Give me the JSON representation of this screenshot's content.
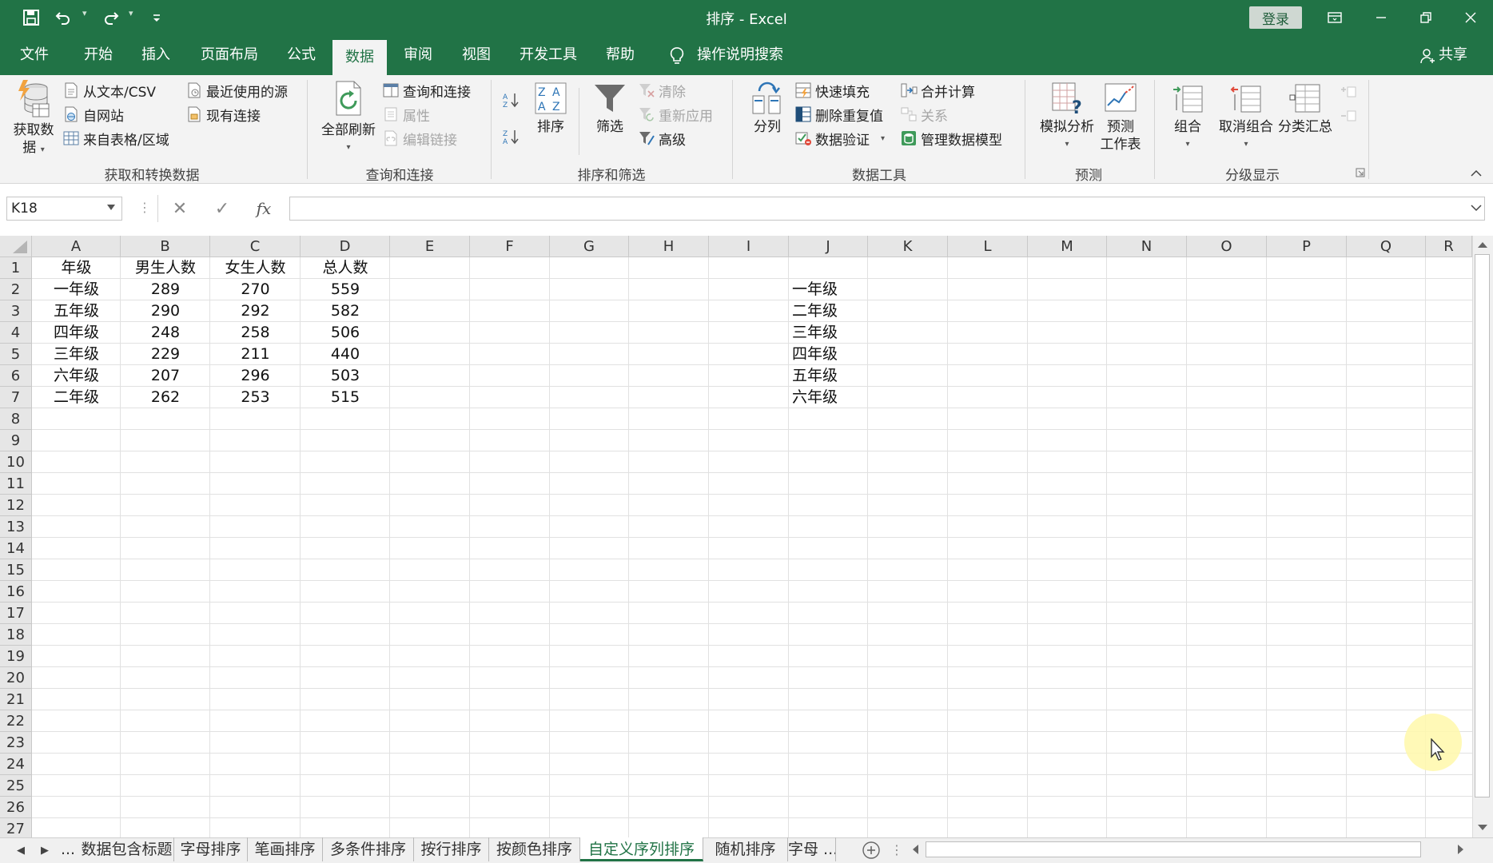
{
  "window": {
    "title": "排序 - Excel",
    "login_label": "登录"
  },
  "ribbon_tabs": [
    {
      "label": "文件"
    },
    {
      "label": "开始"
    },
    {
      "label": "插入"
    },
    {
      "label": "页面布局"
    },
    {
      "label": "公式"
    },
    {
      "label": "数据",
      "active": true
    },
    {
      "label": "审阅"
    },
    {
      "label": "视图"
    },
    {
      "label": "开发工具"
    },
    {
      "label": "帮助"
    }
  ],
  "tell_me": "操作说明搜索",
  "share_label": "共享",
  "ribbon": {
    "get_data": {
      "big_label_1": "获取数",
      "big_label_2": "据",
      "from_text_csv": "从文本/CSV",
      "from_web": "自网站",
      "from_table": "来自表格/区域",
      "recent_sources": "最近使用的源",
      "existing_connections": "现有连接",
      "group_label": "获取和转换数据"
    },
    "queries": {
      "refresh_all": "全部刷新",
      "queries_connections": "查询和连接",
      "properties": "属性",
      "edit_links": "编辑链接",
      "group_label": "查询和连接"
    },
    "sort_filter": {
      "sort": "排序",
      "filter": "筛选",
      "clear": "清除",
      "reapply": "重新应用",
      "advanced": "高级",
      "group_label": "排序和筛选"
    },
    "data_tools": {
      "text_to_columns": "分列",
      "flash_fill": "快速填充",
      "remove_duplicates": "删除重复值",
      "data_validation": "数据验证",
      "consolidate": "合并计算",
      "relationships": "关系",
      "manage_data_model": "管理数据模型",
      "group_label": "数据工具"
    },
    "forecast": {
      "what_if": "模拟分析",
      "forecast_sheet_1": "预测",
      "forecast_sheet_2": "工作表",
      "group_label": "预测"
    },
    "outline": {
      "group": "组合",
      "ungroup": "取消组合",
      "subtotal": "分类汇总",
      "group_label": "分级显示"
    }
  },
  "formula_bar": {
    "name_box": "K18",
    "fx": "fx",
    "formula": ""
  },
  "columns": [
    "A",
    "B",
    "C",
    "D",
    "E",
    "F",
    "G",
    "H",
    "I",
    "J",
    "K",
    "L",
    "M",
    "N",
    "O",
    "P",
    "Q",
    "R"
  ],
  "rows": [
    "1",
    "2",
    "3",
    "4",
    "5",
    "6",
    "7",
    "8",
    "9",
    "10",
    "11",
    "12",
    "13",
    "14",
    "15",
    "16",
    "17",
    "18",
    "19",
    "20",
    "21",
    "22",
    "23",
    "24",
    "25",
    "26",
    "27"
  ],
  "table": {
    "headers": [
      "年级",
      "男生人数",
      "女生人数",
      "总人数"
    ],
    "rows": [
      [
        "一年级",
        "289",
        "270",
        "559"
      ],
      [
        "五年级",
        "290",
        "292",
        "582"
      ],
      [
        "四年级",
        "248",
        "258",
        "506"
      ],
      [
        "三年级",
        "229",
        "211",
        "440"
      ],
      [
        "六年级",
        "207",
        "296",
        "503"
      ],
      [
        "二年级",
        "262",
        "253",
        "515"
      ]
    ]
  },
  "custom_list": [
    "一年级",
    "二年级",
    "三年级",
    "四年级",
    "五年级",
    "六年级"
  ],
  "sheet_tabs": {
    "overflow": "...",
    "tabs": [
      {
        "label": "数据包含标题"
      },
      {
        "label": "字母排序"
      },
      {
        "label": "笔画排序"
      },
      {
        "label": "多条件排序"
      },
      {
        "label": "按行排序"
      },
      {
        "label": "按颜色排序"
      },
      {
        "label": "自定义序列排序",
        "active": true
      },
      {
        "label": "随机排序"
      },
      {
        "label": "字母 ..."
      }
    ]
  },
  "colors": {
    "excel_green": "#217346",
    "ribbon_bg": "#f3f3f3",
    "header_bg": "#e6e6e6",
    "cursor_halo": "#fff8aa"
  }
}
